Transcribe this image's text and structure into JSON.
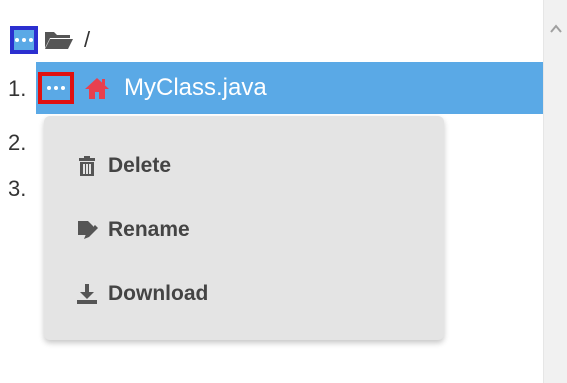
{
  "root": {
    "path": "/",
    "folder_icon": "folder-open-icon",
    "menu_icon": "ellipsis-icon"
  },
  "list": {
    "line_numbers": [
      "1.",
      "2.",
      "3."
    ],
    "selected_item": {
      "name": "MyClass.java",
      "icon": "home-icon",
      "menu_icon": "ellipsis-icon"
    }
  },
  "context_menu": {
    "items": [
      {
        "label": "Delete",
        "icon": "trash-icon"
      },
      {
        "label": "Rename",
        "icon": "rename-icon"
      },
      {
        "label": "Download",
        "icon": "download-icon"
      }
    ]
  },
  "colors": {
    "selection": "#5aa9e6",
    "home_icon": "#e8404f",
    "highlight_root": "#2b2fd0",
    "highlight_item": "#e01010",
    "menu_bg": "#e4e4e4"
  }
}
